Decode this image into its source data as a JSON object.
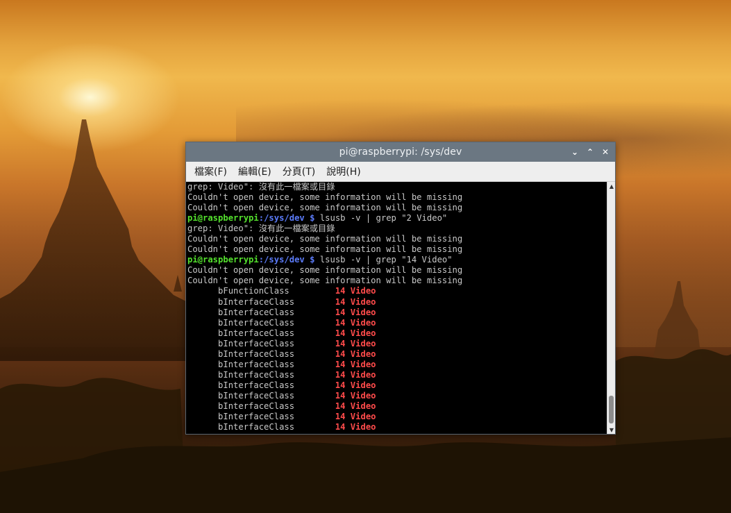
{
  "window": {
    "title": "pi@raspberrypi: /sys/dev",
    "controls": {
      "minimize": "⌄",
      "maximize": "⌃",
      "close": "✕"
    }
  },
  "menu": [
    "檔案(F)",
    "編輯(E)",
    "分頁(T)",
    "說明(H)"
  ],
  "terminal": {
    "prompt": {
      "user": "pi@raspberrypi",
      "path": ":/sys/dev",
      "symbol": " $"
    },
    "lines": [
      "grep: Video\": 沒有此一檔案或目錄",
      "Couldn't open device, some information will be missing",
      "Couldn't open device, some information will be missing",
      "grep: Video\": 沒有此一檔案或目錄",
      "Couldn't open device, some information will be missing",
      "Couldn't open device, some information will be missing",
      "Couldn't open device, some information will be missing",
      "Couldn't open device, some information will be missing"
    ],
    "commands": [
      " lsusb -v | grep \"2 Video\"",
      " lsusb -v | grep \"14 Video\""
    ],
    "match_rows": [
      {
        "field": "      bFunctionClass         ",
        "value": "14 Video"
      },
      {
        "field": "      bInterfaceClass        ",
        "value": "14 Video"
      },
      {
        "field": "      bInterfaceClass        ",
        "value": "14 Video"
      },
      {
        "field": "      bInterfaceClass        ",
        "value": "14 Video"
      },
      {
        "field": "      bInterfaceClass        ",
        "value": "14 Video"
      },
      {
        "field": "      bInterfaceClass        ",
        "value": "14 Video"
      },
      {
        "field": "      bInterfaceClass        ",
        "value": "14 Video"
      },
      {
        "field": "      bInterfaceClass        ",
        "value": "14 Video"
      },
      {
        "field": "      bInterfaceClass        ",
        "value": "14 Video"
      },
      {
        "field": "      bInterfaceClass        ",
        "value": "14 Video"
      },
      {
        "field": "      bInterfaceClass        ",
        "value": "14 Video"
      },
      {
        "field": "      bInterfaceClass        ",
        "value": "14 Video"
      },
      {
        "field": "      bInterfaceClass        ",
        "value": "14 Video"
      },
      {
        "field": "      bInterfaceClass        ",
        "value": "14 Video"
      }
    ]
  },
  "scrollbar": {
    "up": "▲",
    "down": "▼"
  },
  "colors": {
    "prompt_user": "#54e22d",
    "prompt_path": "#5c7cfa",
    "highlight": "#ff4b4b",
    "titlebar": "#6b7782"
  }
}
